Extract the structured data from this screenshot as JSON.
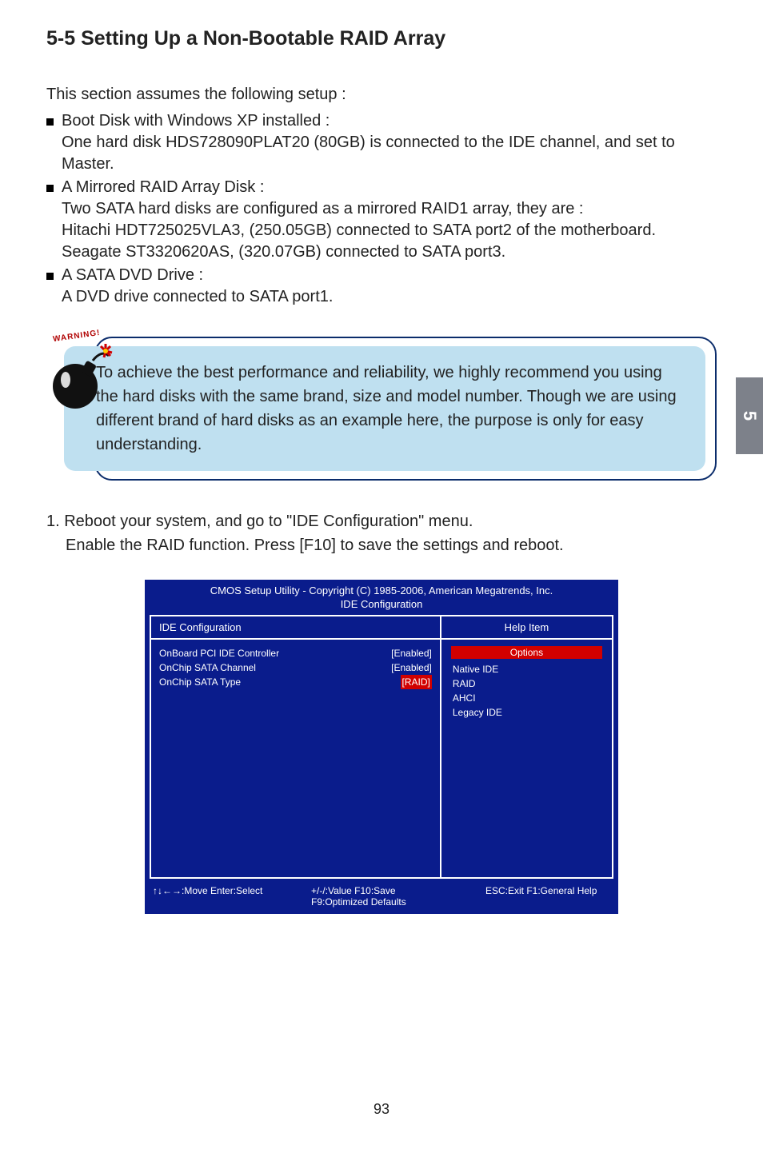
{
  "heading": "5-5 Setting Up a Non-Bootable RAID Array",
  "intro": "This section assumes the following setup :",
  "bullets": [
    {
      "title": "Boot Disk with Windows XP installed :",
      "lines": [
        "One hard disk HDS728090PLAT20 (80GB) is connected to the IDE channel, and set to Master."
      ]
    },
    {
      "title": "A Mirrored RAID Array Disk :",
      "lines": [
        "Two SATA hard disks are configured as a mirrored RAID1 array, they are :",
        "Hitachi HDT725025VLA3, (250.05GB) connected to SATA port2 of the motherboard.",
        "Seagate ST3320620AS, (320.07GB) connected to SATA port3."
      ]
    },
    {
      "title": "A SATA DVD Drive :",
      "lines": [
        "A DVD drive connected to SATA port1."
      ]
    }
  ],
  "warning_label": "WARNING!",
  "callout": "To achieve the best performance and reliability, we highly recommend you using the hard disks with the same brand, size and model number. Though we are using different brand of hard disks as an example here, the purpose is only for easy understanding.",
  "step1_line1": "1. Reboot your system, and go to \"IDE Configuration\" menu.",
  "step1_line2": "Enable the RAID function. Press [F10] to save the settings and reboot.",
  "bios": {
    "title": "CMOS Setup Utility - Copyright (C) 1985-2006, American Megatrends, Inc.",
    "subtitle": "IDE Configuration",
    "left_header": "IDE Configuration",
    "rows": [
      {
        "label": "OnBoard PCI IDE Controller",
        "value": "[Enabled]",
        "raid": false
      },
      {
        "label": "OnChip SATA Channel",
        "value": "[Enabled]",
        "raid": false
      },
      {
        "label": "OnChip SATA Type",
        "value": "[RAID]",
        "raid": true
      }
    ],
    "right_header": "Help Item",
    "options_title": "Options",
    "options": [
      "Native IDE",
      "RAID",
      "AHCI",
      "Legacy IDE"
    ],
    "footer": {
      "move": "↑↓←→:Move   Enter:Select",
      "value": "+/-/:Value     F10:Save",
      "defaults": "F9:Optimized Defaults",
      "exit": "ESC:Exit     F1:General Help"
    }
  },
  "side_tab": "5",
  "page_num": "93"
}
